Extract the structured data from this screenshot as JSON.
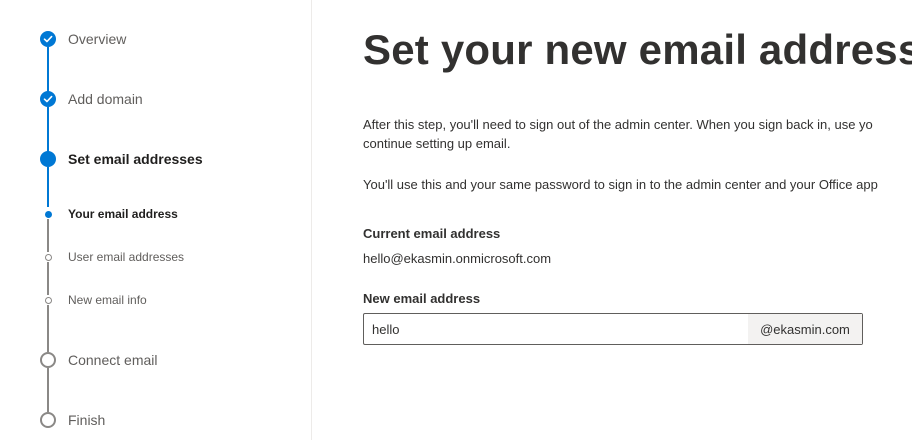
{
  "wizard": {
    "steps": [
      {
        "label": "Overview",
        "state": "done"
      },
      {
        "label": "Add domain",
        "state": "done"
      },
      {
        "label": "Set email addresses",
        "state": "current"
      },
      {
        "label": "Connect email",
        "state": "pending"
      },
      {
        "label": "Finish",
        "state": "pending"
      }
    ],
    "substeps": [
      {
        "label": "Your email address",
        "state": "current"
      },
      {
        "label": "User email addresses",
        "state": "pending"
      },
      {
        "label": "New email info",
        "state": "pending"
      }
    ]
  },
  "main": {
    "title": "Set your new email address",
    "paragraph1_line1": "After this step, you'll need to sign out of the admin center. When you sign back in, use yo",
    "paragraph1_line2": "continue setting up email.",
    "paragraph2": "You'll use this and your same password to sign in to the admin center and your Office app",
    "current_label": "Current email address",
    "current_value": "hello@ekasmin.onmicrosoft.com",
    "new_label": "New email address",
    "new_value": "hello",
    "domain_suffix": "@ekasmin.com"
  },
  "colors": {
    "accent": "#0078d4",
    "pending": "#8a8886"
  }
}
